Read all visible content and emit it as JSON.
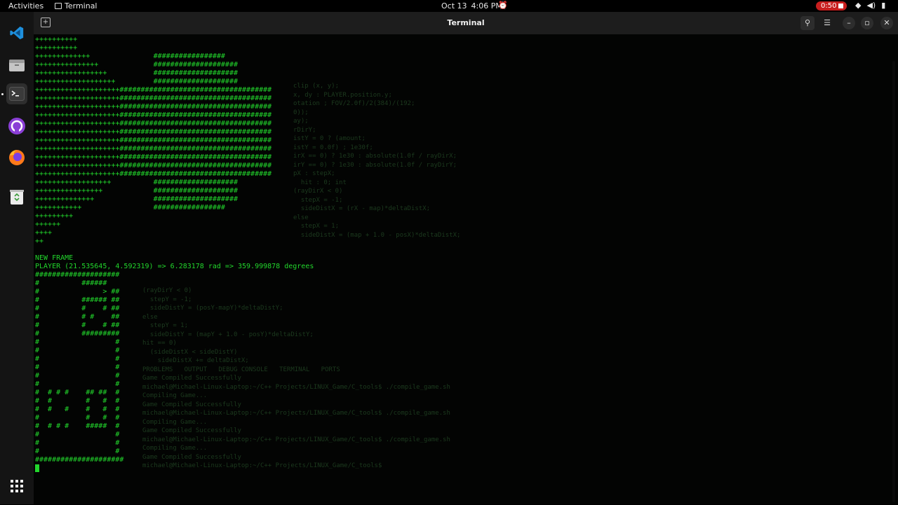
{
  "topbar": {
    "activities": "Activities",
    "app_name": "Terminal",
    "date": "Oct 13",
    "time": "4:06 PM",
    "recording": "0:50"
  },
  "dock": {
    "items": [
      {
        "name": "vscode-icon",
        "label": "Visual Studio Code"
      },
      {
        "name": "files-icon",
        "label": "Files"
      },
      {
        "name": "terminal-icon",
        "label": "Terminal"
      },
      {
        "name": "github-desktop-icon",
        "label": "GitHub Desktop"
      },
      {
        "name": "firefox-icon",
        "label": "Firefox"
      },
      {
        "name": "trash-icon",
        "label": "Trash"
      },
      {
        "name": "app-grid-icon",
        "label": "Show Applications"
      }
    ]
  },
  "window": {
    "title": "Terminal"
  },
  "terminal": {
    "lines": [
      "++++++++++",
      "++++++++++",
      "+++++++++++++               #################",
      "+++++++++++++++             ####################",
      "+++++++++++++++++           ####################",
      "+++++++++++++++++++         ####################",
      "++++++++++++++++++++####################################",
      "++++++++++++++++++++####################################",
      "++++++++++++++++++++####################################",
      "++++++++++++++++++++####################################",
      "++++++++++++++++++++####################################",
      "++++++++++++++++++++####################################",
      "++++++++++++++++++++####################################",
      "++++++++++++++++++++####################################",
      "++++++++++++++++++++####################################",
      "++++++++++++++++++++####################################",
      "++++++++++++++++++++####################################",
      "++++++++++++++++++          ####################",
      "++++++++++++++++            ####################",
      "++++++++++++++              ####################",
      "+++++++++++                 #################",
      "+++++++++",
      "++++++",
      "++++",
      "++",
      "",
      "NEW FRAME",
      "PLAYER (21.535645, 4.592319) => 6.283178 rad => 359.999878 degrees",
      "####################",
      "#          ######",
      "#               > ##",
      "#          ###### ##",
      "#          #    # ##",
      "#          # #    ##",
      "#          #    # ##",
      "#          #########",
      "#                  #",
      "#                  #",
      "#                  #",
      "#                  #",
      "#                  #",
      "#                  #",
      "#  # # #    ## ##  #",
      "#  #        #   #  #",
      "#  #   #    #   #  #",
      "#           #   #  #",
      "#  # # #    #####  #",
      "#                  #",
      "#                  #",
      "#                  #",
      "#####################"
    ],
    "ghost_lines": [
      "clip (x, y);",
      "",
      "x, dy : PLAYER.position.y;",
      "otation ; FOV/2.0f)/2(384)/(192;",
      "0));",
      "",
      "ay);",
      "rDirY;",
      "istY = 0 ? (amount;",
      "istY = 0.0f) ; 1e30f;",
      "irX == 0) ? 1e30 : absolute(1.0f / rayDirX;",
      "irY == 0) ? 1e30 : absolute(1.0f / rayDirY;",
      "",
      "pX : stepX;",
      "  hit : 0; int",
      "(rayDirX < 0)",
      "  stepX = -1;",
      "  sideDistX = (rX - map)*deltaDistX;",
      "else",
      "  stepX = 1;",
      "  sideDistX = (map + 1.0 - posX)*deltaDistX;"
    ],
    "ghost_lines_2": [
      "(rayDirY < 0)",
      "  stepY = -1;",
      "  sideDistY = (posY-mapY)*deltaDistY;",
      "else",
      "  stepY = 1;",
      "  sideDistY = (mapY + 1.0 - posY)*deltaDistY;",
      "",
      "hit == 0)",
      "  (sideDistX < sideDistY)",
      "    sideDistX += deltaDistX;",
      "",
      "PROBLEMS   OUTPUT   DEBUG CONSOLE   TERMINAL   PORTS",
      "",
      "Game Compiled Successfully",
      "michael@Michael-Linux-Laptop:~/C++ Projects/LINUX_Game/C_tools$ ./compile_game.sh",
      "Compiling Game...",
      "Game Compiled Successfully",
      "michael@Michael-Linux-Laptop:~/C++ Projects/LINUX_Game/C_tools$ ./compile_game.sh",
      "Compiling Game...",
      "Game Compiled Successfully",
      "michael@Michael-Linux-Laptop:~/C++ Projects/LINUX_Game/C_tools$ ./compile_game.sh",
      "Compiling Game...",
      "Game Compiled Successfully",
      "michael@Michael-Linux-Laptop:~/C++ Projects/LINUX_Game/C_tools$"
    ]
  },
  "colors": {
    "terminal_green": "#22d62c",
    "terminal_bg": "#030403",
    "titlebar_bg": "#1d1d1d",
    "record_red": "#c81e1e"
  }
}
